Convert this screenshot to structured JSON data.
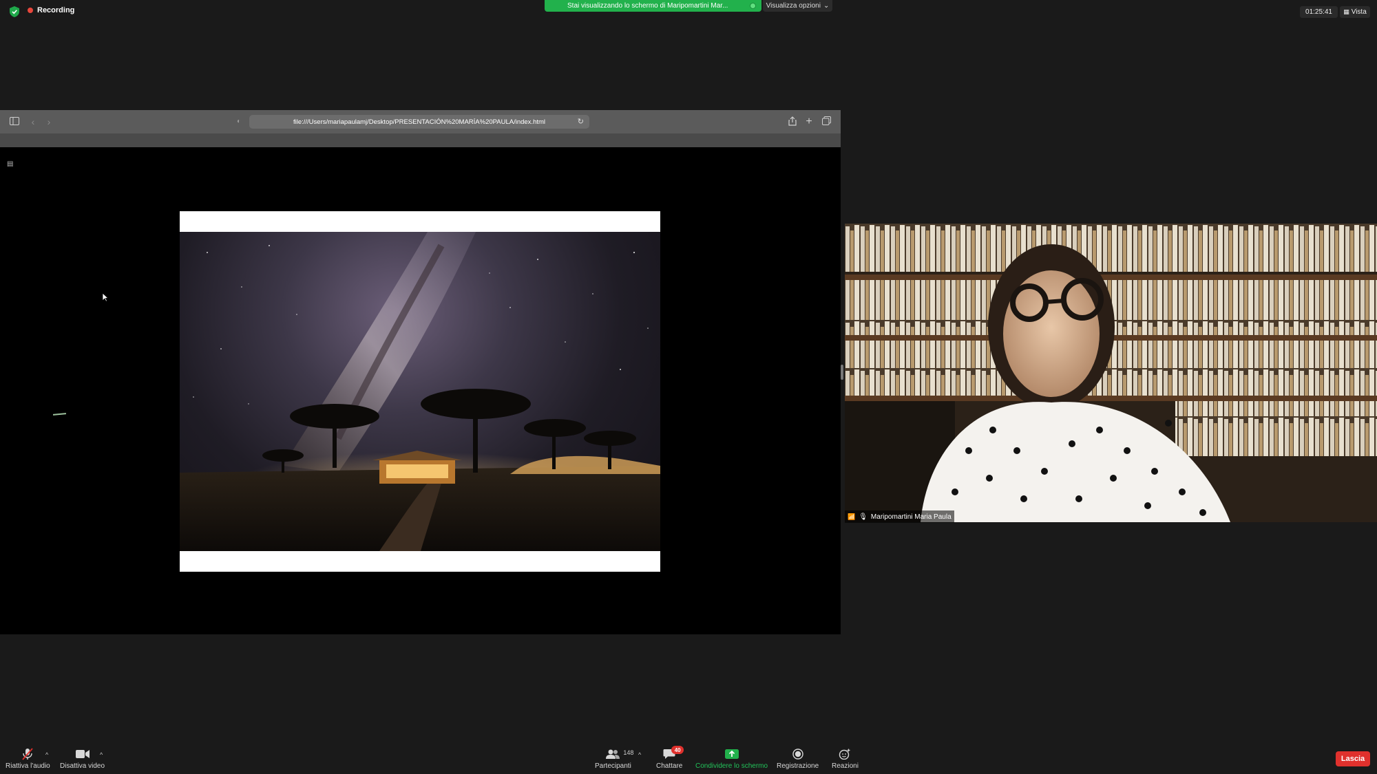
{
  "topbar": {
    "recording_label": "Recording",
    "share_banner": "Stai visualizzando lo schermo di Maripomartini Mar...",
    "view_options": "Visualizza opzioni",
    "time": "01:25:41",
    "view_label": "Vista"
  },
  "browser": {
    "url": "file:///Users/mariapaulamj/Desktop/PRESENTACIÓN%20MARÍA%20PAULA/index.html"
  },
  "participant": {
    "name": "Maripomartini Maria Paula"
  },
  "toolbar": {
    "mute": "Riattiva l'audio",
    "video": "Disattiva video",
    "participants": "Partecipanti",
    "participants_count": "148",
    "chat": "Chattare",
    "chat_badge": "40",
    "share": "Condividere lo schermo",
    "record": "Registrazione",
    "reactions": "Reazioni",
    "leave": "Lascia"
  },
  "colors": {
    "share_green": "#22b14c",
    "leave_red": "#e0312d",
    "recording_dot": "#e8473c"
  }
}
